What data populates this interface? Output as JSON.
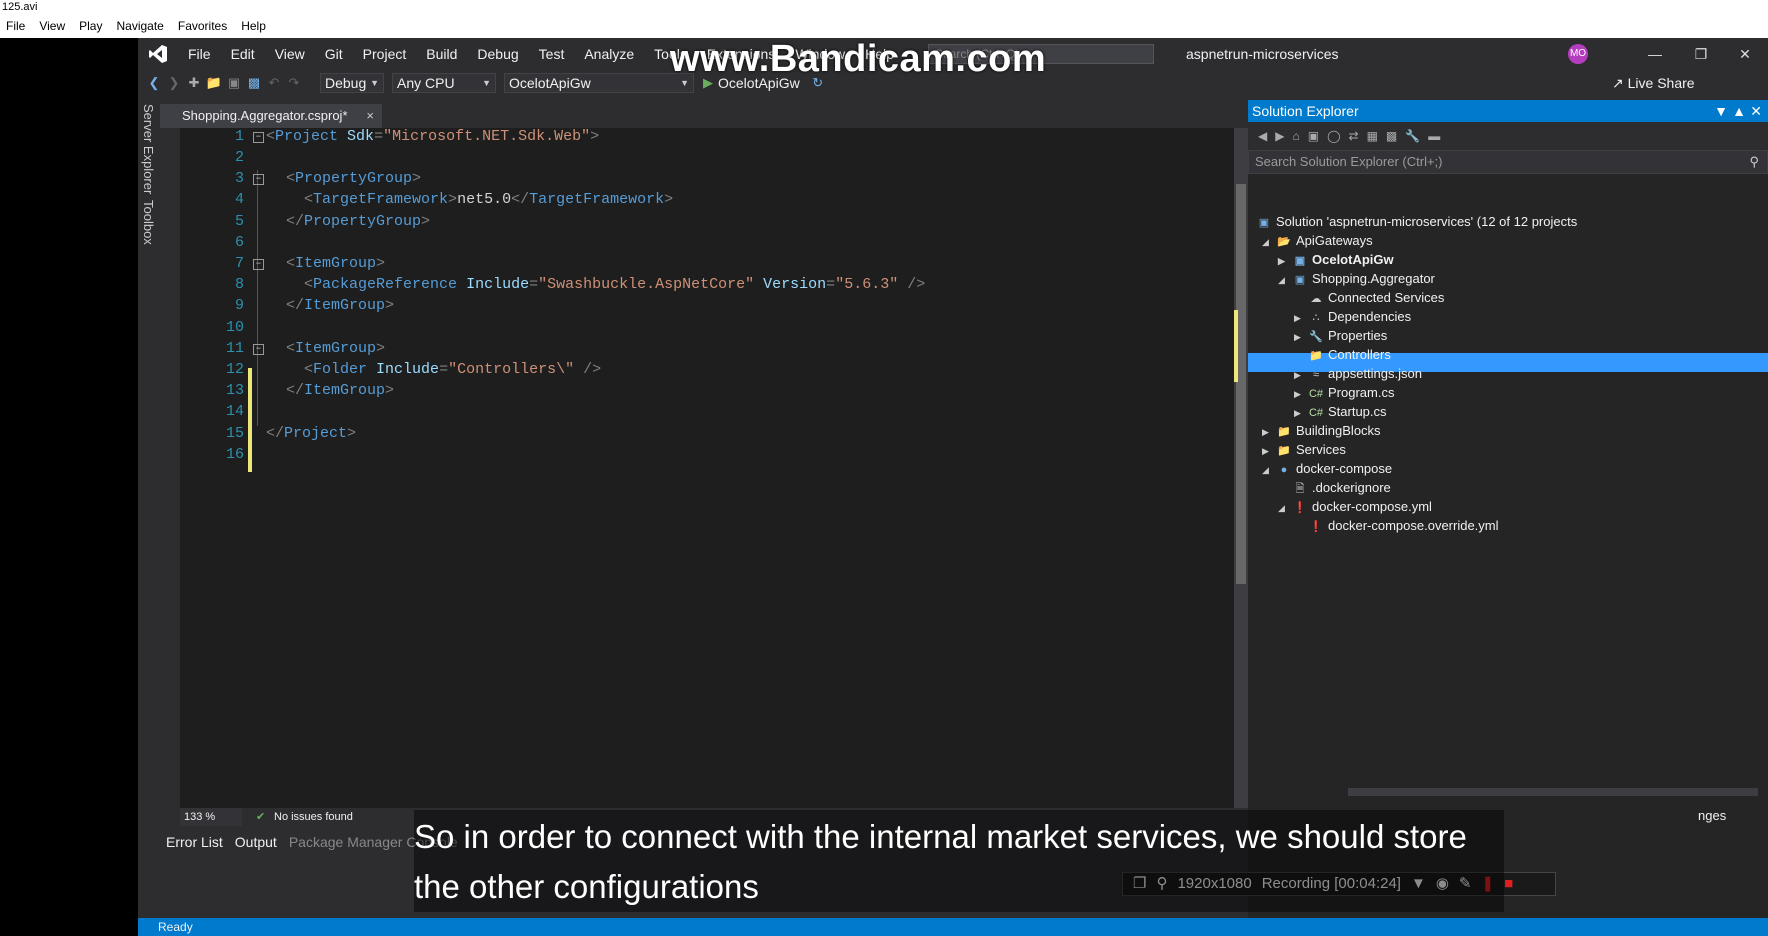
{
  "player": {
    "title": "125.avi",
    "menu": [
      "File",
      "View",
      "Play",
      "Navigate",
      "Favorites",
      "Help"
    ]
  },
  "vs": {
    "menu": [
      "File",
      "Edit",
      "View",
      "Git",
      "Project",
      "Build",
      "Debug",
      "Test",
      "Analyze",
      "Tools",
      "Extensions",
      "Window",
      "Help"
    ],
    "search_placeholder": "Search (Ctrl+Q)",
    "solution_name": "aspnetrun-microservices",
    "avatar_initials": "MO",
    "toolbar": {
      "config": "Debug",
      "platform": "Any CPU",
      "startup_project": "OcelotApiGw",
      "run_label": "OcelotApiGw",
      "live_share": "Live Share"
    },
    "side_tabs": [
      "Server Explorer",
      "Toolbox"
    ],
    "doc_tab": "Shopping.Aggregator.csproj*",
    "code_lines": [
      {
        "n": "1"
      },
      {
        "n": "2"
      },
      {
        "n": "3"
      },
      {
        "n": "4"
      },
      {
        "n": "5"
      },
      {
        "n": "6"
      },
      {
        "n": "7"
      },
      {
        "n": "8"
      },
      {
        "n": "9"
      },
      {
        "n": "10"
      },
      {
        "n": "11"
      },
      {
        "n": "12"
      },
      {
        "n": "13"
      },
      {
        "n": "14"
      },
      {
        "n": "15"
      },
      {
        "n": "16"
      }
    ],
    "code": {
      "l1_tag": "Project",
      "l1_attr": "Sdk",
      "l1_val": "\"Microsoft.NET.Sdk.Web\"",
      "l3_tag": "PropertyGroup",
      "l4_tag": "TargetFramework",
      "l4_text": "net5.0",
      "l7_tag": "ItemGroup",
      "l8_tag": "PackageReference",
      "l8_attr1": "Include",
      "l8_val1": "\"Swashbuckle.AspNetCore\"",
      "l8_attr2": "Version",
      "l8_val2": "\"5.6.3\"",
      "l12_tag": "Folder",
      "l12_attr": "Include",
      "l12_val": "\"Controllers\\\"",
      "l15_tag": "Project"
    },
    "zoom": "133 %",
    "issues": "No issues found",
    "bottom_tabs": [
      "Error List",
      "Output",
      "Package Manager Console"
    ],
    "status_text": "Ready"
  },
  "solution_explorer": {
    "title": "Solution Explorer",
    "search_placeholder": "Search Solution Explorer (Ctrl+;)",
    "nodes": [
      {
        "label": "Solution 'aspnetrun-microservices' (12 of 12 projects"
      },
      {
        "label": "ApiGateways"
      },
      {
        "label": "OcelotApiGw"
      },
      {
        "label": "Shopping.Aggregator"
      },
      {
        "label": "Connected Services"
      },
      {
        "label": "Dependencies"
      },
      {
        "label": "Properties"
      },
      {
        "label": "Controllers"
      },
      {
        "label": "appsettings.json"
      },
      {
        "label": "Program.cs"
      },
      {
        "label": "Startup.cs"
      },
      {
        "label": "BuildingBlocks"
      },
      {
        "label": "Services"
      },
      {
        "label": "docker-compose"
      },
      {
        "label": ".dockerignore"
      },
      {
        "label": "docker-compose.yml"
      },
      {
        "label": "docker-compose.override.yml"
      }
    ],
    "bottom_partial": "nges"
  },
  "overlay": {
    "watermark": "www.Bandicam.com",
    "resolution": "1920x1080",
    "recording": "Recording [00:04:24]",
    "subtitle": "So in order to connect with the internal market services, we should store the other configurations"
  }
}
